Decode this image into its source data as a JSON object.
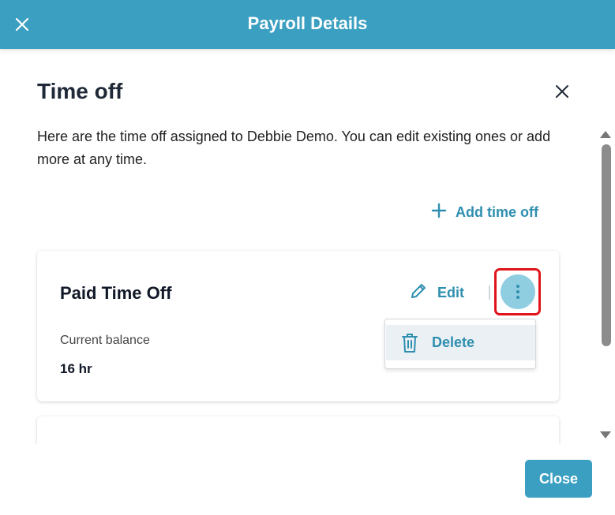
{
  "header": {
    "title": "Payroll Details",
    "close_icon": "close-icon"
  },
  "panel": {
    "title": "Time off",
    "description": "Here are the time off assigned to Debbie Demo. You can edit existing ones or add more at any time.",
    "add_label": "Add time off"
  },
  "card": {
    "title": "Paid Time Off",
    "edit_label": "Edit",
    "balance_label": "Current balance",
    "balance_value": "16 hr"
  },
  "menu": {
    "delete_label": "Delete"
  },
  "footer": {
    "close_label": "Close"
  },
  "colors": {
    "brand": "#3a9fc0",
    "accent_text": "#2f8fb0",
    "highlight": "#e0141b"
  }
}
